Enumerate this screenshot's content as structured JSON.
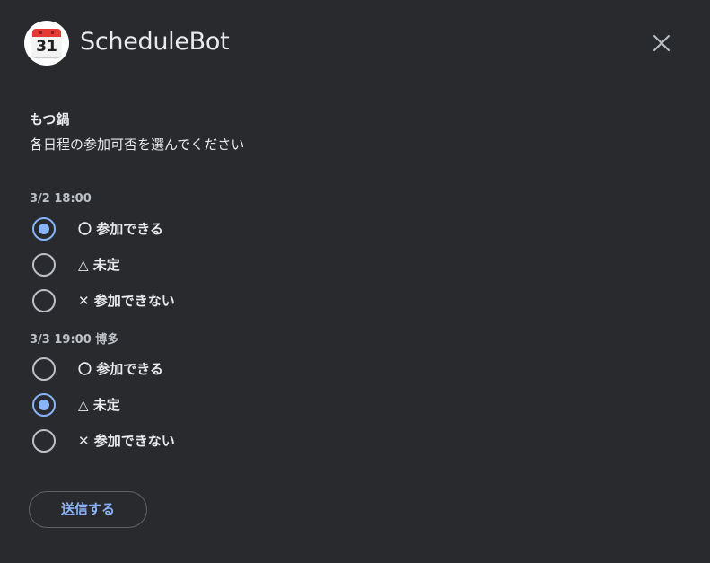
{
  "header": {
    "app_name": "ScheduleBot",
    "avatar_icon": "calendar-icon",
    "avatar_day": "31",
    "close_icon": "close-icon"
  },
  "form": {
    "title": "もつ鍋",
    "description": "各日程の参加可否を選んでください",
    "groups": [
      {
        "label": "3/2 18:00",
        "options": [
          {
            "label": "〇 参加できる",
            "selected": true
          },
          {
            "label": "△ 未定",
            "selected": false
          },
          {
            "label": "✕ 参加できない",
            "selected": false
          }
        ]
      },
      {
        "label": "3/3 19:00 博多",
        "options": [
          {
            "label": "〇 参加できる",
            "selected": false
          },
          {
            "label": "△ 未定",
            "selected": true
          },
          {
            "label": "✕ 参加できない",
            "selected": false
          }
        ]
      }
    ],
    "submit_label": "送信する"
  },
  "colors": {
    "background": "#292a2d",
    "accent": "#8ab4f8",
    "text": "#e8eaed",
    "muted": "#bdc1c6"
  }
}
